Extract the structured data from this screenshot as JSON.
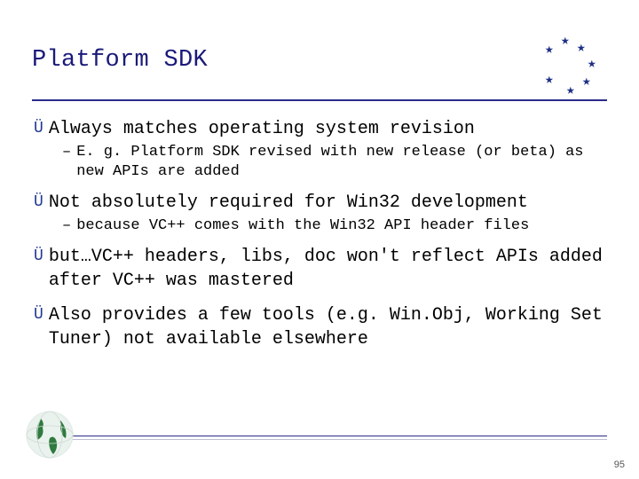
{
  "slide": {
    "title": "Platform SDK",
    "bullets": [
      {
        "text": "Always matches operating system revision",
        "sub": [
          "E. g. Platform SDK revised with new release (or beta) as new APIs are added"
        ]
      },
      {
        "text": "Not absolutely required for Win32 development",
        "sub": [
          "because VC++ comes with the Win32 API header files"
        ]
      },
      {
        "text": "but…VC++ headers, libs, doc won't reflect APIs added after VC++ was mastered",
        "sub": []
      },
      {
        "text": "Also provides a few tools (e.g. Win.Obj, Working Set Tuner) not available elsewhere",
        "sub": []
      }
    ],
    "page_number": "95",
    "icons": {
      "stars": "eu-stars-logo",
      "globe": "globe-icon"
    },
    "colors": {
      "title": "#1a1a7a",
      "rule": "#2b2b8b",
      "arrow": "#223892"
    }
  }
}
